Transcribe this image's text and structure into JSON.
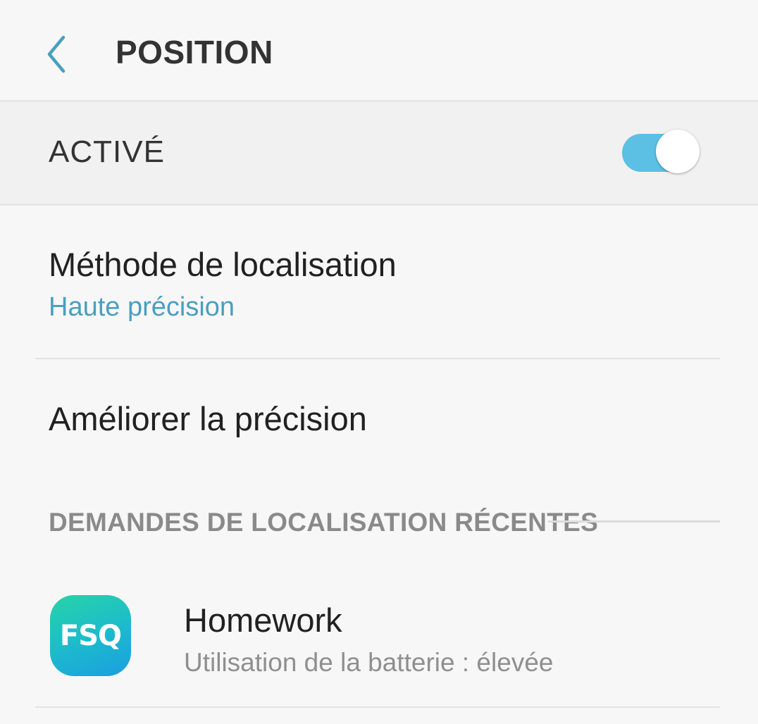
{
  "header": {
    "title": "POSITION",
    "back_icon": "chevron-left-icon"
  },
  "master_switch": {
    "label": "ACTIVÉ",
    "state": "on",
    "accent_color": "#5bc0e4"
  },
  "settings": {
    "method": {
      "title": "Méthode de localisation",
      "value": "Haute précision",
      "value_color": "#4a9fbf"
    },
    "improve": {
      "title": "Améliorer la précision"
    }
  },
  "recent_requests": {
    "section_title": "DEMANDES DE LOCALISATION RÉCENTES",
    "apps": [
      {
        "name": "Homework",
        "detail": "Utilisation de la batterie : élevée",
        "icon_text": "FSQ"
      }
    ]
  }
}
